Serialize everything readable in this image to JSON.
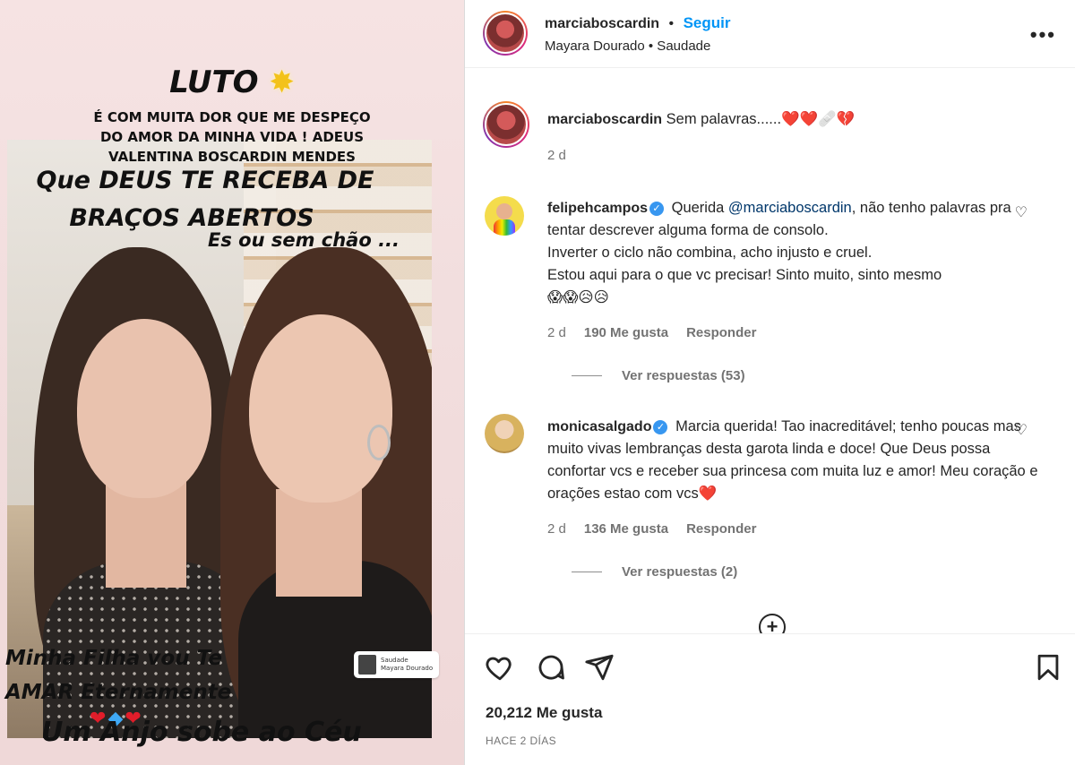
{
  "story": {
    "luto": "LUTO",
    "message_lines": [
      "É COM MUITA DOR QUE ME DESPEÇO",
      "DO AMOR DA MINHA VIDA ! ADEUS",
      "VALENTINA BOSCARDIN  MENDES"
    ],
    "deus": "Que DEUS TE RECEBA DE",
    "bracos": "BRAÇOS ABERTOS",
    "sem_chao": "Es ou sem chão ...",
    "filha_line1": "Minha Filha vou  Te",
    "filha_line2": "AMAR Eternamente",
    "anjo": "Um Anjo sobe ao Céu",
    "music_title": "Saudade",
    "music_artist": "Mayara Dourado"
  },
  "header": {
    "username": "marciaboscardin",
    "separator": "•",
    "follow": "Seguir",
    "audio": "Mayara Dourado • Saudade"
  },
  "caption": {
    "username": "marciaboscardin",
    "text": "Sem palavras......",
    "emojis": "❤️❤️🩹💔",
    "time": "2 d"
  },
  "comments": [
    {
      "username": "felipehcampos",
      "mention": "@marciaboscardin",
      "text_before": "Querida",
      "text_after": ", não tenho palavras pra tentar descrever alguma forma de consolo.",
      "line2": "Inverter o ciclo não combina, acho injusto e cruel.",
      "line3": "Estou aqui para o que vc precisar! Sinto muito, sinto mesmo",
      "emojis": "😱😱😥😥",
      "time": "2 d",
      "likes": "190 Me gusta",
      "reply": "Responder",
      "view_replies": "Ver respuestas (53)"
    },
    {
      "username": "monicasalgado",
      "text": "Marcia querida! Tao inacreditável; tenho poucas mas muito vivas lembranças desta garota linda e doce! Que Deus possa confortar vcs e receber sua princesa com muita luz e amor! Meu coração e orações estao com vcs",
      "emoji": "❤️",
      "time": "2 d",
      "likes": "136 Me gusta",
      "reply": "Responder",
      "view_replies": "Ver respuestas (2)"
    }
  ],
  "footer": {
    "likes": "20,212 Me gusta",
    "date": "HACE 2 DÍAS"
  },
  "colors": {
    "link": "#0095f6",
    "verified": "#3897f0",
    "muted": "#737373",
    "text": "#262626"
  },
  "icons": [
    "more-icon",
    "verified-icon",
    "heart-icon",
    "comment-icon",
    "share-icon",
    "bookmark-icon",
    "add-comment-icon"
  ]
}
